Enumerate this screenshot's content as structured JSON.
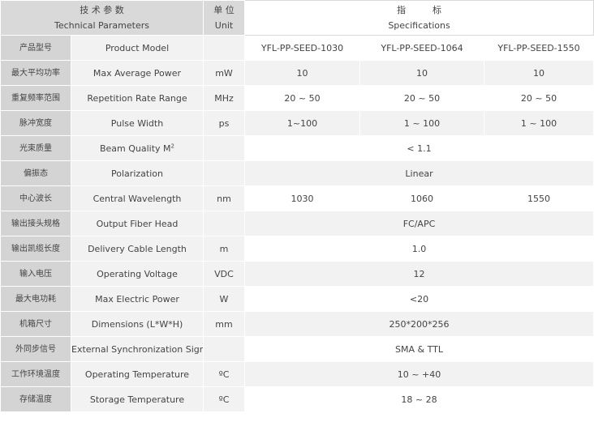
{
  "header": {
    "param_cn": "技 术 参 数",
    "param_en": "Technical Parameters",
    "unit_cn": "单 位",
    "unit_en": "Unit",
    "spec_cn": "指　　　标",
    "spec_en": "Specifications"
  },
  "rows": [
    {
      "cn": "产品型号",
      "en": "Product Model",
      "unit": "",
      "values": [
        "YFL-PP-SEED-1030",
        "YFL-PP-SEED-1064",
        "YFL-PP-SEED-1550"
      ]
    },
    {
      "cn": "最大平均功率",
      "en": "Max Average Power",
      "unit": "mW",
      "values": [
        "10",
        "10",
        "10"
      ]
    },
    {
      "cn": "重复频率范围",
      "en": "Repetition Rate Range",
      "unit": "MHz",
      "values": [
        "20 ~ 50",
        "20 ~ 50",
        "20 ~ 50"
      ]
    },
    {
      "cn": "脉冲宽度",
      "en": "Pulse Width",
      "unit": "ps",
      "values": [
        "1~100",
        "1 ~ 100",
        "1 ~ 100"
      ]
    },
    {
      "cn": "光束质量",
      "en": "Beam Quality M",
      "en_sup": "2",
      "unit": "",
      "value": "< 1.1"
    },
    {
      "cn": "偏振态",
      "en": "Polarization",
      "unit": "",
      "value": "Linear"
    },
    {
      "cn": "中心波长",
      "en": "Central Wavelength",
      "unit": "nm",
      "values": [
        "1030",
        "1060",
        "1550"
      ]
    },
    {
      "cn": "输出接头规格",
      "en": "Output Fiber Head",
      "unit": "",
      "value": "FC/APC"
    },
    {
      "cn": "输出凯缆长度",
      "en": "Delivery Cable Length",
      "unit": "m",
      "value": "1.0"
    },
    {
      "cn": "输入电压",
      "en": "Operating Voltage",
      "unit": "VDC",
      "value": "12"
    },
    {
      "cn": "最大电功耗",
      "en": "Max Electric Power",
      "unit": "W",
      "value": "<20"
    },
    {
      "cn": "机箱尺寸",
      "en": "Dimensions (L*W*H)",
      "unit": "mm",
      "value": "250*200*256"
    },
    {
      "cn": "外同步信号",
      "en": "External Synchronization Signal",
      "unit": "",
      "value": "SMA & TTL"
    },
    {
      "cn": "工作环境温度",
      "en": "Operating Temperature",
      "unit": "ºC",
      "value": "10 ~ +40"
    },
    {
      "cn": "存储温度",
      "en": "Storage Temperature",
      "unit": "ºC",
      "value": "18 ~ 28"
    }
  ]
}
